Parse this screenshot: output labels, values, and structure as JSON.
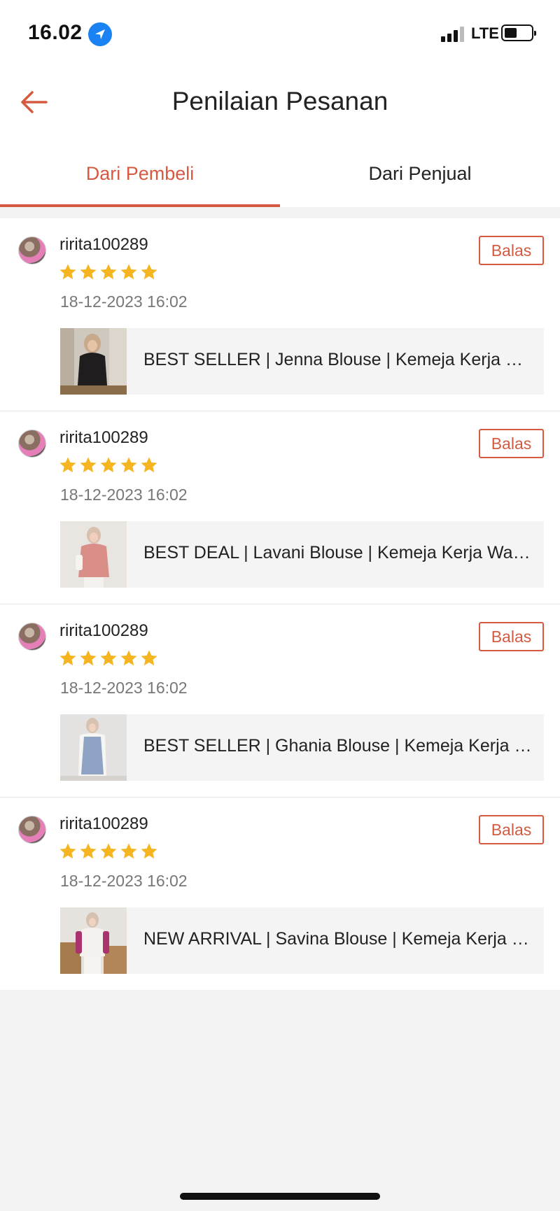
{
  "status_bar": {
    "time": "16.02",
    "network": "LTE",
    "battery_level": 0.45
  },
  "header": {
    "title": "Penilaian Pesanan"
  },
  "tabs": [
    {
      "label": "Dari Pembeli",
      "active": true
    },
    {
      "label": "Dari Penjual",
      "active": false
    }
  ],
  "reviews": [
    {
      "username": "ririta100289",
      "rating": 5,
      "date": "18-12-2023 16:02",
      "reply_label": "Balas",
      "product": "BEST SELLER | Jenna Blouse | Kemeja Kerja Wanita | Atasan Kerja | Blouse Busui Friendly"
    },
    {
      "username": "ririta100289",
      "rating": 5,
      "date": "18-12-2023 16:02",
      "reply_label": "Balas",
      "product": "BEST DEAL | Lavani Blouse | Kemeja Kerja Wanita | Atasan Kerja | Blouse Busui Friendly"
    },
    {
      "username": "ririta100289",
      "rating": 5,
      "date": "18-12-2023 16:02",
      "reply_label": "Balas",
      "product": "BEST SELLER | Ghania Blouse | Kemeja Kerja Wanita | Atasan Kerja | Blouse Busui Friendly"
    },
    {
      "username": "ririta100289",
      "rating": 5,
      "date": "18-12-2023 16:02",
      "reply_label": "Balas",
      "product": "NEW ARRIVAL | Savina Blouse | Kemeja Kerja Wanita | Atasan Kerja | Blouse Busui Friendly"
    }
  ],
  "colors": {
    "accent": "#d55a40",
    "star": "#f5b520",
    "background": "#f3f3f3"
  }
}
